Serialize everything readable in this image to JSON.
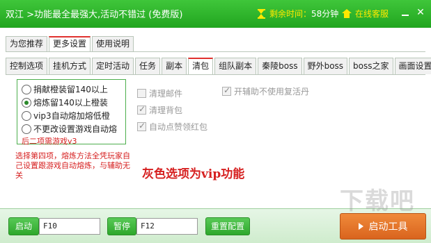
{
  "titlebar": {
    "title": "双江 >功能最全最强大,活动不错过 (免费版)",
    "timer_label": "剩余时间：",
    "timer_value": "58分钟",
    "service_label": "在线客服",
    "minimize": "–",
    "close": "✕"
  },
  "tabs_top": [
    "为您推荐",
    "更多设置",
    "使用说明"
  ],
  "tabs_top_active": 1,
  "tabs_sub": [
    "控制选项",
    "挂机方式",
    "定时活动",
    "任务",
    "副本",
    "清包",
    "组队副本",
    "秦陵boss",
    "野外boss",
    "boss之家",
    "画面设置"
  ],
  "tabs_sub_active": 5,
  "options": {
    "radios": [
      {
        "label": "捐献橙装留140以上",
        "checked": false
      },
      {
        "label": "熔炼留140以上橙装",
        "checked": true
      },
      {
        "label": "vip3自动熔加熔低橙",
        "checked": false
      },
      {
        "label": "不更改设置游戏自动熔",
        "checked": false
      }
    ],
    "footnote": "后二项需游戏v3"
  },
  "note_red": "选择第四项，熔炼方法全凭玩家自己设置跟游戏自动熔炼，与辅助无关",
  "vip_note": "灰色选项为vip功能",
  "checkboxes": [
    {
      "label": "清理邮件",
      "checked": false
    },
    {
      "label": "清理背包",
      "checked": true
    },
    {
      "label": "自动点赞领红包",
      "checked": true
    },
    {
      "label": "开辅助不使用复活丹",
      "checked": true
    }
  ],
  "bottom": {
    "start_label": "启动",
    "start_hotkey": "F10",
    "pause_label": "暂停",
    "pause_hotkey": "F12",
    "reset_label": "重置配置",
    "launch_label": "启动工具"
  },
  "watermark": "下载吧",
  "colors": {
    "titlebar": "#2aae27",
    "accent_red": "#d62020",
    "tab_active_border": "#e0312e",
    "launch_button": "#e8782c"
  }
}
